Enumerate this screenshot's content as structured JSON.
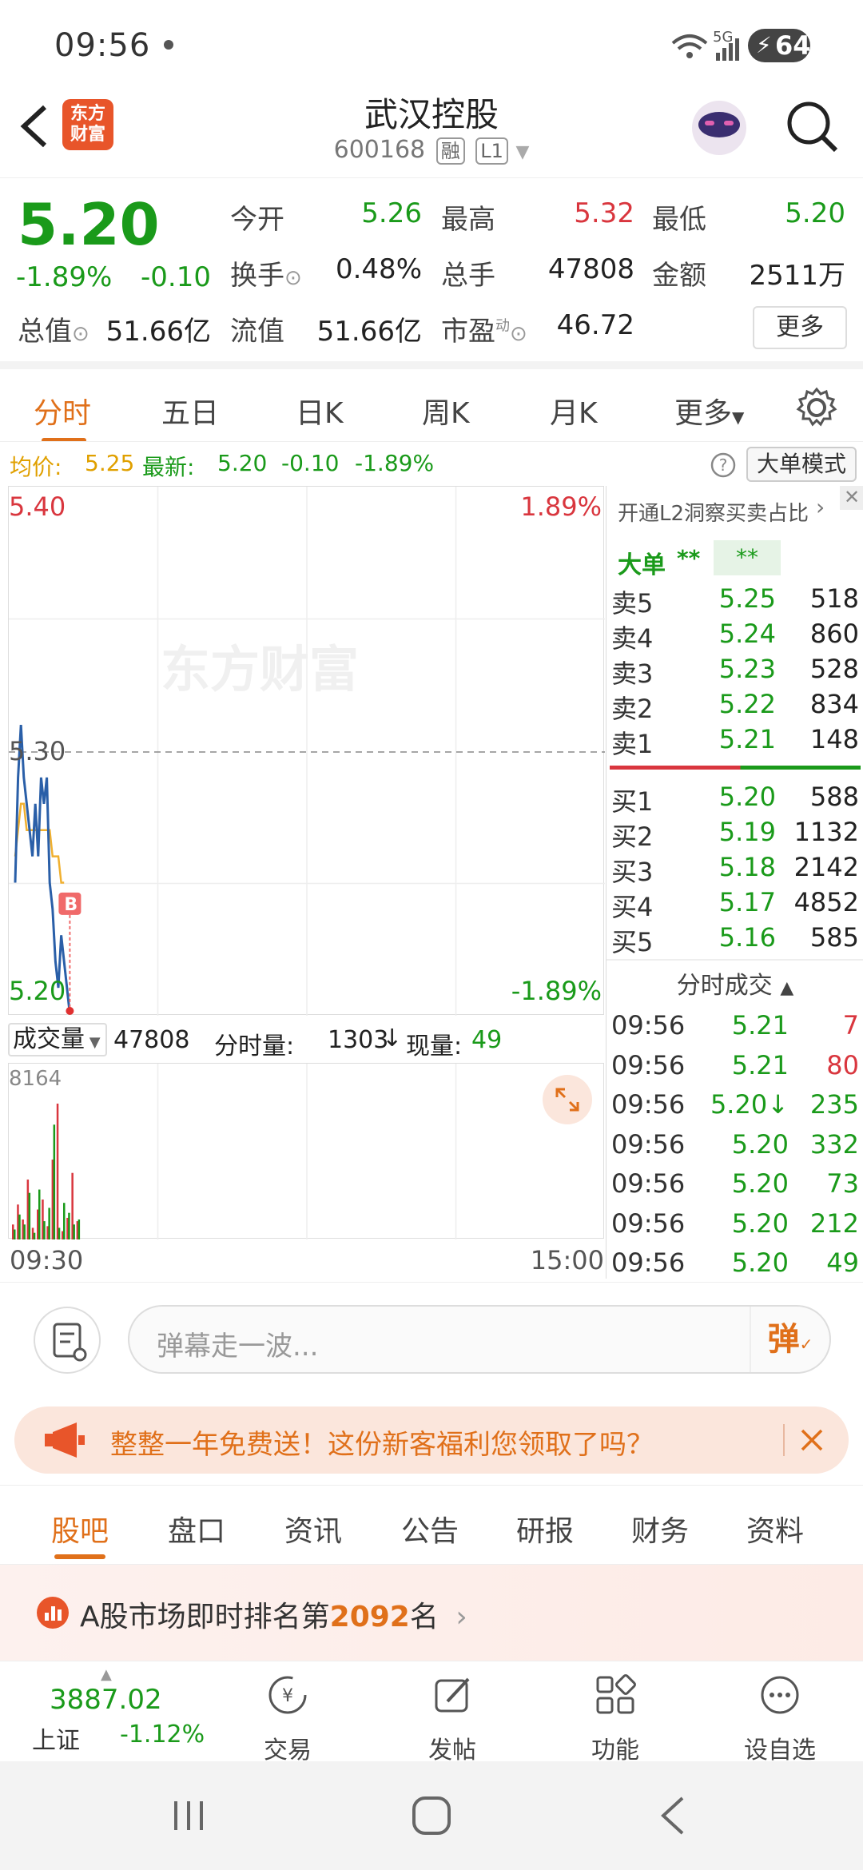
{
  "status": {
    "time": "09:56",
    "network": "5G",
    "battery": "64"
  },
  "header": {
    "title": "武汉控股",
    "code": "600168",
    "tag_rong": "融",
    "tag_level": "L1",
    "logo_line1": "东方",
    "logo_line2": "财富"
  },
  "quote": {
    "price": "5.20",
    "change_pct": "-1.89%",
    "change": "-0.10",
    "open_label": "今开",
    "open": "5.26",
    "high_label": "最高",
    "high": "5.32",
    "low_label": "最低",
    "low": "5.20",
    "turnover_label": "换手",
    "turnover": "0.48%",
    "volume_label": "总手",
    "volume": "47808",
    "amount_label": "金额",
    "amount": "2511万",
    "mcap_label": "总值",
    "mcap": "51.66亿",
    "float_label": "流值",
    "float": "51.66亿",
    "pe_label": "市盈",
    "pe_sup": "动",
    "pe": "46.72",
    "more": "更多"
  },
  "tabs": [
    "分时",
    "五日",
    "日K",
    "周K",
    "月K",
    "更多"
  ],
  "avg_line": {
    "avg_label": "均价:",
    "avg": "5.25",
    "latest_label": "最新:",
    "latest": "5.20",
    "change": "-0.10",
    "change_pct": "-1.89%",
    "mode_button": "大单模式"
  },
  "chart_data": {
    "type": "line",
    "y_top": "5.40",
    "y_mid": "5.30",
    "y_bottom": "5.20",
    "pct_top": "1.89%",
    "pct_bottom": "-1.89%",
    "ylim": [
      5.2,
      5.4
    ],
    "watermark": "东方财富",
    "marker": "B",
    "price_series": [
      5.25,
      5.29,
      5.31,
      5.29,
      5.28,
      5.27,
      5.26,
      5.28,
      5.26,
      5.29,
      5.28,
      5.29,
      5.25,
      5.24,
      5.22,
      5.21,
      5.23,
      5.22,
      5.21,
      5.2
    ],
    "avg_series": [
      5.26,
      5.27,
      5.28,
      5.28,
      5.27,
      5.27,
      5.27,
      5.27,
      5.27,
      5.27,
      5.27,
      5.27,
      5.27,
      5.26,
      5.26,
      5.26,
      5.25,
      5.25
    ],
    "volume_max": "8164",
    "volume_up": [
      900,
      2100,
      1200,
      3600,
      700,
      1800,
      2400,
      800,
      4800,
      8164,
      500,
      1300,
      4000,
      1100
    ],
    "volume_down": [
      600,
      1500,
      900,
      2800,
      400,
      3000,
      1100,
      1900,
      6900,
      700,
      2200,
      1600,
      900,
      1200
    ],
    "x_start": "09:30",
    "x_end": "15:00"
  },
  "volume_bar": {
    "label": "成交量",
    "total": "47808",
    "fenshi_label": "分时量:",
    "fenshi": "1303",
    "now_label": "现量:",
    "now": "49"
  },
  "side": {
    "l2_banner": "开通L2洞察买卖占比",
    "big_label": "大单",
    "big_a": "**",
    "big_b": "**",
    "asks": [
      {
        "label": "卖5",
        "price": "5.25",
        "vol": "518"
      },
      {
        "label": "卖4",
        "price": "5.24",
        "vol": "860"
      },
      {
        "label": "卖3",
        "price": "5.23",
        "vol": "528"
      },
      {
        "label": "卖2",
        "price": "5.22",
        "vol": "834"
      },
      {
        "label": "卖1",
        "price": "5.21",
        "vol": "148"
      }
    ],
    "bids": [
      {
        "label": "买1",
        "price": "5.20",
        "vol": "588"
      },
      {
        "label": "买2",
        "price": "5.19",
        "vol": "1132"
      },
      {
        "label": "买3",
        "price": "5.18",
        "vol": "2142"
      },
      {
        "label": "买4",
        "price": "5.17",
        "vol": "4852"
      },
      {
        "label": "买5",
        "price": "5.16",
        "vol": "585"
      }
    ],
    "trades_label": "分时成交",
    "trades": [
      {
        "time": "09:56",
        "price": "5.21",
        "vol": "7",
        "color": "#d9363e"
      },
      {
        "time": "09:56",
        "price": "5.21",
        "vol": "80",
        "color": "#d9363e"
      },
      {
        "time": "09:56",
        "price": "5.20↓",
        "vol": "235",
        "color": "#1a9a1a"
      },
      {
        "time": "09:56",
        "price": "5.20",
        "vol": "332",
        "color": "#1a9a1a"
      },
      {
        "time": "09:56",
        "price": "5.20",
        "vol": "73",
        "color": "#1a9a1a"
      },
      {
        "time": "09:56",
        "price": "5.20",
        "vol": "212",
        "color": "#1a9a1a"
      },
      {
        "time": "09:56",
        "price": "5.20",
        "vol": "49",
        "color": "#1a9a1a"
      }
    ]
  },
  "comment": {
    "placeholder": "弹幕走一波...",
    "danmu_button": "弹"
  },
  "promo": {
    "text": "整整一年免费送！这份新客福利您领取了吗？"
  },
  "bottom_tabs": [
    "股吧",
    "盘口",
    "资讯",
    "公告",
    "研报",
    "财务",
    "资料"
  ],
  "rank": {
    "prefix": "A股市场即时排名第",
    "num": "2092",
    "suffix": "名"
  },
  "bottom_nav": {
    "index_value": "3887.02",
    "index_name": "上证",
    "index_change": "-1.12%",
    "items": [
      "交易",
      "发帖",
      "功能",
      "设自选"
    ]
  },
  "colors": {
    "accent": "#e0701a",
    "up": "#d9363e",
    "down": "#1a9a1a",
    "price_line": "#2a5fa8",
    "avg_line": "#f0b030"
  }
}
